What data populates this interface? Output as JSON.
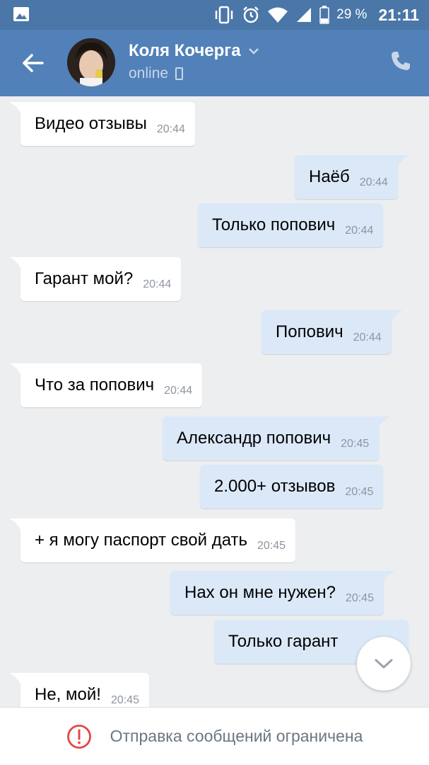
{
  "statusbar": {
    "battery_percent": "29 %",
    "time": "21:11"
  },
  "header": {
    "contact_name": "Коля Кочерга",
    "status": "online"
  },
  "messages": [
    {
      "dir": "in",
      "text": "Видео отзывы",
      "time": "20:44"
    },
    {
      "dir": "out",
      "text": "Наёб",
      "time": "20:44"
    },
    {
      "dir": "out",
      "text": "Только попович",
      "time": "20:44"
    },
    {
      "dir": "in",
      "text": "Гарант мой?",
      "time": "20:44"
    },
    {
      "dir": "out",
      "text": "Попович",
      "time": "20:44"
    },
    {
      "dir": "in",
      "text": "Что за попович",
      "time": "20:44"
    },
    {
      "dir": "out",
      "text": "Александр попович",
      "time": "20:45"
    },
    {
      "dir": "out",
      "text": "2.000+ отзывов",
      "time": "20:45"
    },
    {
      "dir": "in",
      "text": "+ я могу паспорт свой дать",
      "time": "20:45"
    },
    {
      "dir": "out",
      "text": "Нах он мне нужен?",
      "time": "20:45"
    },
    {
      "dir": "out",
      "text": "Только гарант",
      "time": ""
    },
    {
      "dir": "in",
      "text": "Не, мой!",
      "time": "20:45"
    }
  ],
  "footer": {
    "restriction_text": "Отправка сообщений ограничена"
  },
  "colors": {
    "header_bg": "#5181b8",
    "statusbar_bg": "#4a76a8",
    "chat_bg": "#edeef0",
    "incoming_bubble": "#ffffff",
    "outgoing_bubble": "#dbe8f8",
    "warning_red": "#e64646"
  },
  "icons": [
    "gallery-icon",
    "vibrate-icon",
    "alarm-icon",
    "wifi-icon",
    "signal-icon",
    "battery-icon",
    "back-arrow-icon",
    "chevron-down-icon",
    "mobile-phone-icon",
    "phone-call-icon",
    "scroll-down-icon",
    "warning-icon"
  ]
}
